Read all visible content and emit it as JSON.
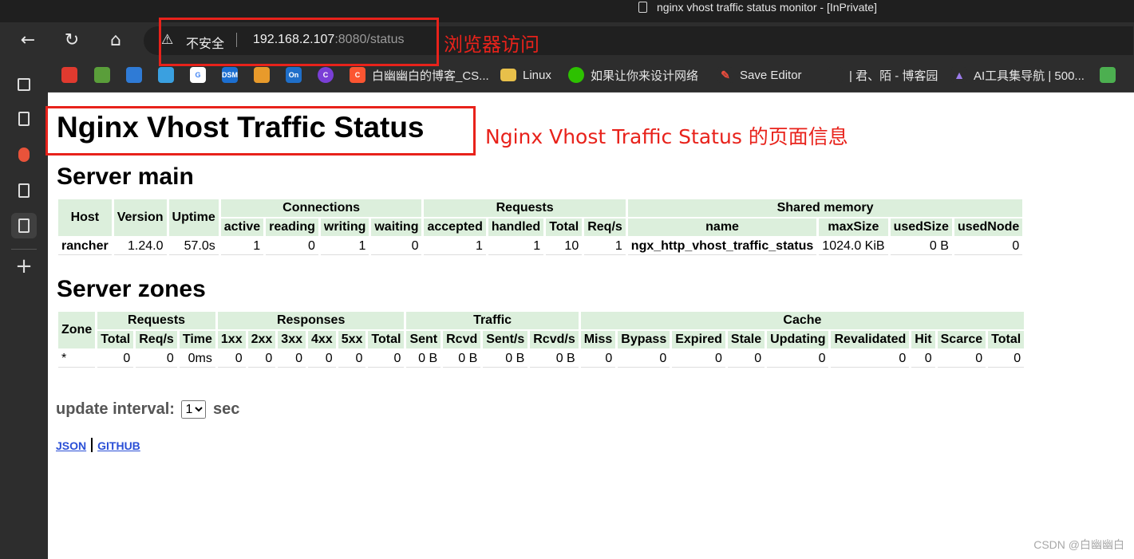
{
  "window": {
    "title": "nginx vhost traffic status monitor - [InPrivate]"
  },
  "toolbar": {
    "security_label": "不安全",
    "url_host": "192.168.2.107",
    "url_rest": ":8080/status"
  },
  "annotations": {
    "browser_access": "浏览器访问",
    "page_info": "Nginx Vhost Traffic Status 的页面信息"
  },
  "bookmarks": [
    {
      "icon": "12306-icon",
      "label": ""
    },
    {
      "icon": "frog-icon",
      "label": ""
    },
    {
      "icon": "stripes-icon",
      "label": ""
    },
    {
      "icon": "cloud-icon",
      "label": ""
    },
    {
      "icon": "google-icon",
      "label": ""
    },
    {
      "icon": "dsm-icon",
      "label": ""
    },
    {
      "icon": "box-icon",
      "label": ""
    },
    {
      "icon": "onenote-icon",
      "label": ""
    },
    {
      "icon": "c-circle-icon",
      "label": ""
    },
    {
      "icon": "csdn-icon",
      "label": "白幽幽白的博客_CS..."
    },
    {
      "icon": "folder-icon",
      "label": "Linux"
    },
    {
      "icon": "wechat-icon",
      "label": "如果让你来设计网络"
    },
    {
      "icon": "edit-icon",
      "label": "Save Editor"
    },
    {
      "icon": "blog-icon",
      "label": "| 君、陌 - 博客园"
    },
    {
      "icon": "ai-icon",
      "label": "AI工具集导航 | 500..."
    },
    {
      "icon": "grid-icon",
      "label": ""
    }
  ],
  "page": {
    "title": "Nginx Vhost Traffic Status",
    "server_main_heading": "Server main",
    "server_zones_heading": "Server zones",
    "update_interval_label": "update interval:",
    "update_interval_value": "1",
    "update_interval_unit": "sec",
    "link_json": "JSON",
    "link_github": "GITHUB"
  },
  "server_main": {
    "headers": {
      "host": "Host",
      "version": "Version",
      "uptime": "Uptime",
      "connections": "Connections",
      "requests": "Requests",
      "shared_memory": "Shared memory",
      "active": "active",
      "reading": "reading",
      "writing": "writing",
      "waiting": "waiting",
      "accepted": "accepted",
      "handled": "handled",
      "total": "Total",
      "req_s": "Req/s",
      "name": "name",
      "max_size": "maxSize",
      "used_size": "usedSize",
      "used_node": "usedNode"
    },
    "row": {
      "host": "rancher",
      "version": "1.24.0",
      "uptime": "57.0s",
      "active": "1",
      "reading": "0",
      "writing": "1",
      "waiting": "0",
      "accepted": "1",
      "handled": "1",
      "total": "10",
      "req_s": "1",
      "name": "ngx_http_vhost_traffic_status",
      "max_size": "1024.0 KiB",
      "used_size": "0 B",
      "used_node": "0"
    }
  },
  "server_zones": {
    "headers": {
      "zone": "Zone",
      "requests": "Requests",
      "responses": "Responses",
      "traffic": "Traffic",
      "cache": "Cache",
      "req_total": "Total",
      "req_s": "Req/s",
      "time": "Time",
      "r1xx": "1xx",
      "r2xx": "2xx",
      "r3xx": "3xx",
      "r4xx": "4xx",
      "r5xx": "5xx",
      "resp_total": "Total",
      "sent": "Sent",
      "rcvd": "Rcvd",
      "sent_s": "Sent/s",
      "rcvd_s": "Rcvd/s",
      "miss": "Miss",
      "bypass": "Bypass",
      "expired": "Expired",
      "stale": "Stale",
      "updating": "Updating",
      "revalidated": "Revalidated",
      "hit": "Hit",
      "scarce": "Scarce",
      "cache_total": "Total"
    },
    "row": {
      "zone": "*",
      "req_total": "0",
      "req_s": "0",
      "time": "0ms",
      "r1xx": "0",
      "r2xx": "0",
      "r3xx": "0",
      "r4xx": "0",
      "r5xx": "0",
      "resp_total": "0",
      "sent": "0 B",
      "rcvd": "0 B",
      "sent_s": "0 B",
      "rcvd_s": "0 B",
      "miss": "0",
      "bypass": "0",
      "expired": "0",
      "stale": "0",
      "updating": "0",
      "revalidated": "0",
      "hit": "0",
      "scarce": "0",
      "cache_total": "0"
    }
  },
  "watermark": "CSDN @白幽幽白",
  "colors": {
    "accent_red": "#e8221b",
    "table_header": "#dcefdc",
    "link": "#2a4fd6"
  }
}
